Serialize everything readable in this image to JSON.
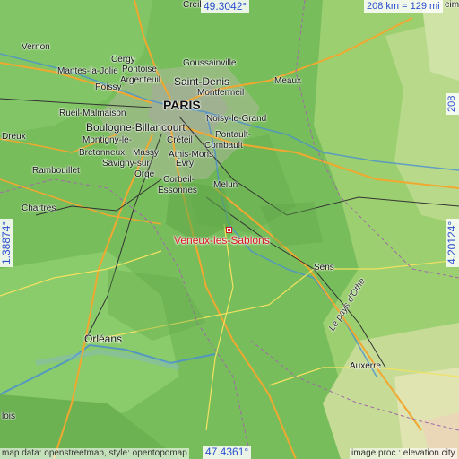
{
  "map": {
    "target": {
      "name": "Veneux-les-Sablons"
    },
    "coords": {
      "lat_top": "49.3042°",
      "lat_bottom": "47.4361°",
      "lon_left": "1.38874°",
      "lon_right": "4.20124°"
    },
    "scale": {
      "horizontal": "208 km = 129 mi",
      "vertical": "208 km = 129 mi"
    },
    "credits": {
      "left": "map data: openstreetmap, style: opentopomap",
      "right": "image proc.: elevation.city"
    },
    "places": {
      "creil": "Creil",
      "vernon": "Vernon",
      "cergy": "Cergy",
      "goussainville": "Goussainville",
      "pontoise": "Pontoise",
      "mantes": "Mantes-la-Jolie",
      "argenteuil": "Argenteuil",
      "saint_denis": "Saint-Denis",
      "meaux": "Meaux",
      "poissy": "Poissy",
      "montfermeil": "Montfermeil",
      "paris": "PARIS",
      "rueil": "Rueil-Malmaison",
      "noisy": "Noisy-le-Grand",
      "dreux": "Dreux",
      "boulogne": "Boulogne-Billancourt",
      "pontault": "Pontault-",
      "combault": "Combault",
      "montigny": "Montigny-le-",
      "bretonneux": "Bretonneux",
      "creteil": "Créteil",
      "massy": "Massy",
      "savigny": "Savigny-sur-",
      "orge": "Orge",
      "athis_mons": "Athis-Mons",
      "evry": "Évry",
      "rambouillet": "Rambouillet",
      "corbeil": "Corbeil-",
      "essonnes": "Essonnes",
      "melun": "Melun",
      "chartres": "Chartres",
      "sens": "Sens",
      "pays_othe": "Le pays d'Othe",
      "orleans": "Orléans",
      "auxerre": "Auxerre",
      "blois": "lois",
      "reims_fragment": "eim"
    }
  }
}
